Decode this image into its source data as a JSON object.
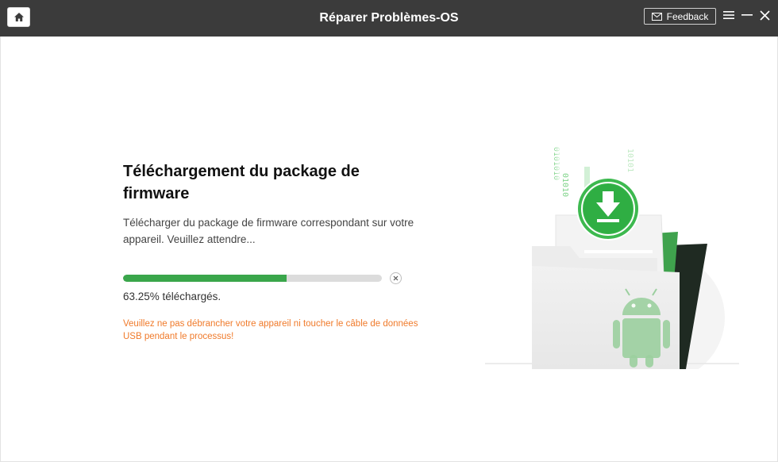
{
  "window": {
    "title": "Réparer Problèmes-OS",
    "feedback_label": "Feedback"
  },
  "icons": {
    "home": "home-icon",
    "mail": "mail-icon",
    "menu": "menu-icon",
    "minimize": "minimize-icon",
    "close": "close-icon",
    "cancel": "cancel-x-icon"
  },
  "main": {
    "heading": "Téléchargement du package de firmware",
    "description": "Télécharger du package de firmware correspondant sur votre appareil. Veuillez attendre...",
    "progress_percent": 63.25,
    "progress_text": "63.25% téléchargés.",
    "warning": "Veuillez ne pas débrancher votre appareil ni toucher le câble de données USB pendant le processus!"
  },
  "illustration": {
    "binary_columns": [
      "0101010",
      "01010",
      "10101"
    ]
  },
  "colors": {
    "titlebar": "#3b3b3b",
    "accent_green": "#3aa64b",
    "warning_orange": "#f07a2a"
  }
}
